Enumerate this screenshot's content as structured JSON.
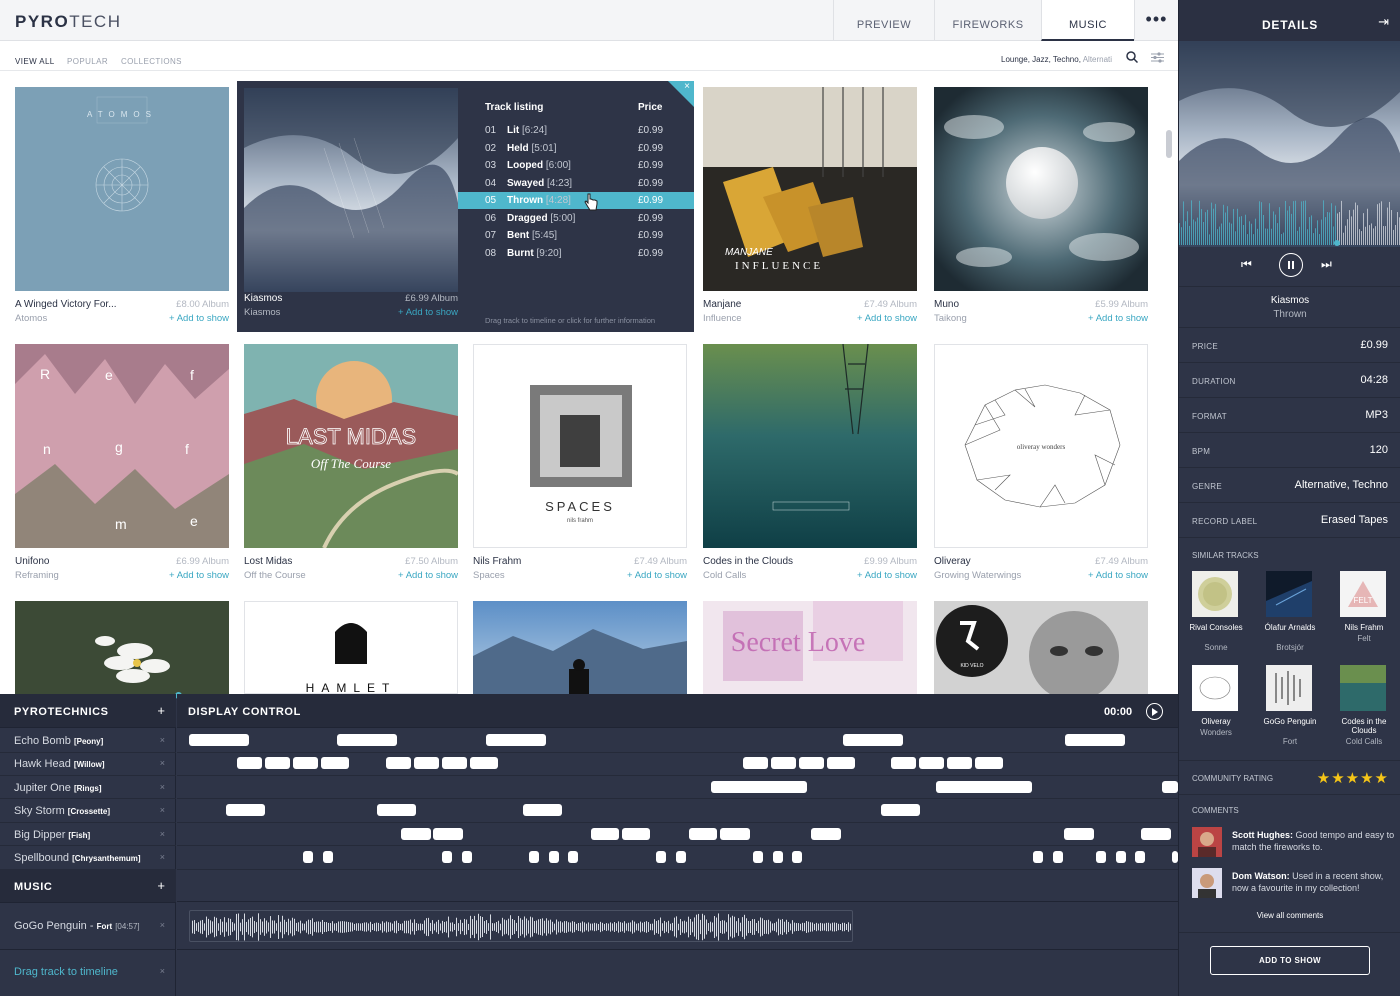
{
  "app": {
    "logo_bold": "PYRO",
    "logo_light": "TECH"
  },
  "nav": {
    "tabs": [
      "PREVIEW",
      "FIREWORKS",
      "MUSIC"
    ],
    "active": "MUSIC",
    "more": "•••"
  },
  "subnav": {
    "tabs": [
      "VIEW ALL",
      "POPULAR",
      "COLLECTIONS"
    ],
    "active": "VIEW ALL",
    "filter": "Lounge, Jazz, Techno,",
    "filter_faded": "Alternati"
  },
  "albums": [
    {
      "title": "A Winged Victory For...",
      "artist": "Atomos",
      "price": "£8.00 Album",
      "add": "+ Add to show",
      "cover_text": "ATOMOS"
    },
    {
      "title": "Kiasmos",
      "artist": "Kiasmos",
      "price": "£6.99 Album",
      "add": "+ Add to show"
    },
    {
      "title": "Manjane",
      "artist": "Influence",
      "price": "£7.49 Album",
      "add": "+ Add to show",
      "cover_text": "INFLUENCE"
    },
    {
      "title": "Muno",
      "artist": "Taikong",
      "price": "£5.99 Album",
      "add": "+ Add to show"
    },
    {
      "title": "Unifono",
      "artist": "Reframing",
      "price": "£6.99 Album",
      "add": "+ Add to show"
    },
    {
      "title": "Lost Midas",
      "artist": "Off the Course",
      "price": "£7.50 Album",
      "add": "+ Add to show",
      "cover_text": "LAST MIDAS"
    },
    {
      "title": "Nils Frahm",
      "artist": "Spaces",
      "price": "£7.49 Album",
      "add": "+ Add to show",
      "cover_text": "SPACES"
    },
    {
      "title": "Codes in the Clouds",
      "artist": "Cold Calls",
      "price": "£9.99 Album",
      "add": "+ Add to show"
    },
    {
      "title": "Oliveray",
      "artist": "Growing Waterwings",
      "price": "£7.49 Album",
      "add": "+ Add to show",
      "cover_text": "oliveray wonders"
    }
  ],
  "row3_covers": [
    {
      "text": ""
    },
    {
      "text": "HAMLET"
    },
    {
      "text": ""
    },
    {
      "text": "Secret Love"
    },
    {
      "text": "KID VELO"
    }
  ],
  "track_panel": {
    "listing_header": "Track listing",
    "price_header": "Price",
    "close": "×",
    "hint": "Drag track to timeline or click for further information",
    "tracks": [
      {
        "num": "01",
        "name": "Lit",
        "dur": "[6:24]",
        "price": "£0.99"
      },
      {
        "num": "02",
        "name": "Held",
        "dur": "[5:01]",
        "price": "£0.99"
      },
      {
        "num": "03",
        "name": "Looped",
        "dur": "[6:00]",
        "price": "£0.99"
      },
      {
        "num": "04",
        "name": "Swayed",
        "dur": "[4:23]",
        "price": "£0.99"
      },
      {
        "num": "05",
        "name": "Thrown",
        "dur": "[4:28]",
        "price": "£0.99",
        "selected": true
      },
      {
        "num": "06",
        "name": "Dragged",
        "dur": "[5:00]",
        "price": "£0.99"
      },
      {
        "num": "07",
        "name": "Bent",
        "dur": "[5:45]",
        "price": "£0.99"
      },
      {
        "num": "08",
        "name": "Burnt",
        "dur": "[9:20]",
        "price": "£0.99"
      }
    ]
  },
  "timeline": {
    "pyro_header": "PYROTECHNICS",
    "display_header": "DISPLAY CONTROL",
    "time": "00:00",
    "plus": "+",
    "remove": "×",
    "pyro": [
      {
        "name": "Echo Bomb",
        "type": "[Peony]"
      },
      {
        "name": "Hawk Head",
        "type": "[Willow]"
      },
      {
        "name": "Jupiter One",
        "type": "[Rings]"
      },
      {
        "name": "Sky Storm",
        "type": "[Crossette]"
      },
      {
        "name": "Big Dipper",
        "type": "[Fish]"
      },
      {
        "name": "Spellbound",
        "type": "[Chrysanthemum]"
      }
    ],
    "music_header": "MUSIC",
    "music_track": {
      "artist": "GoGo Penguin - ",
      "title": "Fort",
      "dur": "[04:57]"
    },
    "drag_hint": "Drag track to timeline"
  },
  "details": {
    "header": "DETAILS",
    "title": "Kiasmos",
    "track": "Thrown",
    "props": [
      {
        "k": "PRICE",
        "v": "£0.99"
      },
      {
        "k": "DURATION",
        "v": "04:28"
      },
      {
        "k": "FORMAT",
        "v": "MP3"
      },
      {
        "k": "BPM",
        "v": "120"
      },
      {
        "k": "GENRE",
        "v": "Alternative, Techno"
      },
      {
        "k": "RECORD LABEL",
        "v": "Erased Tapes"
      }
    ],
    "similar_header": "SIMILAR TRACKS",
    "similar": [
      {
        "a": "Rival Consoles",
        "b": "Sonne"
      },
      {
        "a": "Ólafur Arnalds",
        "b": "Brotsjór"
      },
      {
        "a": "Nils Frahm",
        "b": "Felt"
      },
      {
        "a": "Oliveray",
        "b": "Wonders"
      },
      {
        "a": "GoGo Penguin",
        "b": "Fort"
      },
      {
        "a": "Codes in the Clouds",
        "b": "Cold Calls"
      }
    ],
    "rating_label": "COMMUNITY RATING",
    "rating": 5,
    "stars": "★★★★★",
    "comments_header": "COMMENTS",
    "comments": [
      {
        "name": "Scott Hughes:",
        "text": " Good tempo and easy to match the fireworks to."
      },
      {
        "name": "Dom Watson:",
        "text": " Used in a recent show, now a favourite in my collection!"
      }
    ],
    "view_all": "View all comments",
    "add_button": "ADD TO SHOW"
  }
}
